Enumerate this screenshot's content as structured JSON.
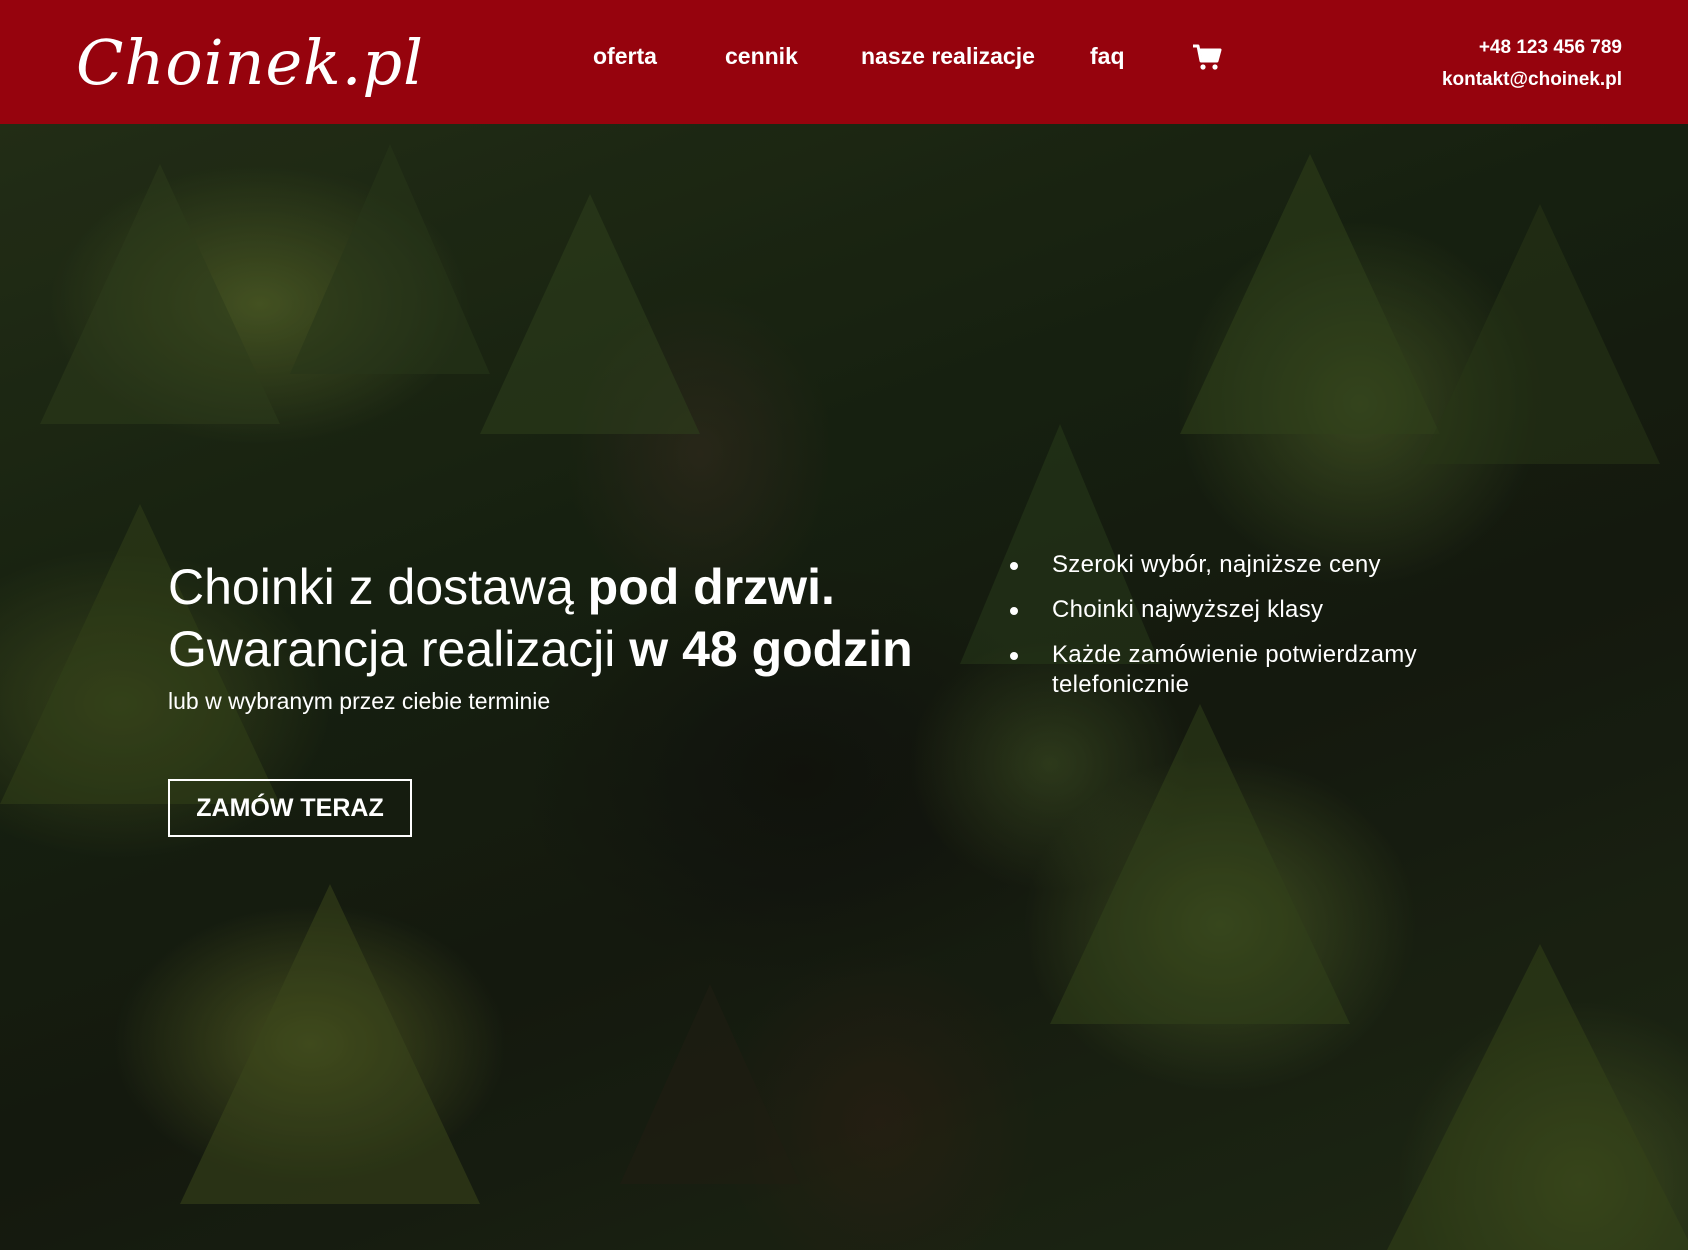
{
  "brand": {
    "logo_text": "Choinek.pl",
    "accent_color": "#96030d"
  },
  "nav": {
    "items": [
      {
        "label": "oferta"
      },
      {
        "label": "cennik"
      },
      {
        "label": "nasze realizacje"
      },
      {
        "label": "faq"
      }
    ],
    "cart_icon": "cart-icon"
  },
  "contact": {
    "phone": "+48 123 456 789",
    "email": "kontakt@choinek.pl"
  },
  "hero": {
    "line1_light": "Choinki z dostawą ",
    "line1_bold": "pod drzwi.",
    "line2_light": "Gwarancja realizacji ",
    "line2_bold": "w 48 godzin",
    "subtitle": "lub w wybranym przez ciebie terminie",
    "cta_label": "ZAMÓW TERAZ",
    "features": [
      "Szeroki wybór, najniższe ceny",
      "Choinki najwyższej klasy",
      "Każde zamówienie potwierdzamy telefonicznie"
    ]
  }
}
